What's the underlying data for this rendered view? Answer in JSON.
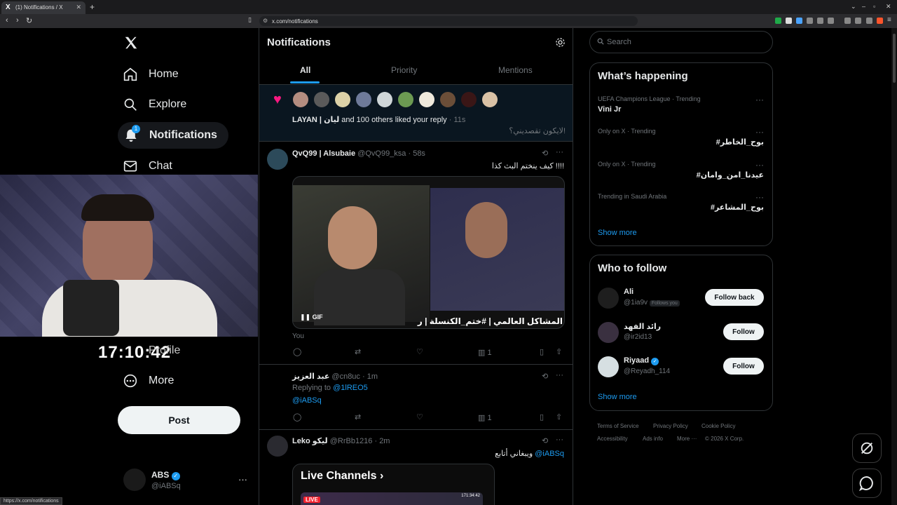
{
  "browser": {
    "tab_title": "(1) Notifications / X",
    "favicon": "X",
    "url": "x.com/notifications",
    "status_url": "https://x.com/notifications"
  },
  "nav": {
    "logo": "X",
    "home": "Home",
    "explore": "Explore",
    "notifications": "Notifications",
    "notifications_badge": "1",
    "chat": "Chat",
    "profile": "Profile",
    "more": "More",
    "post": "Post",
    "account": {
      "name": "ABS",
      "handle": "@iABSq"
    }
  },
  "webcam": {
    "clock": "17:10:42"
  },
  "notifications": {
    "title": "Notifications",
    "tabs": [
      "All",
      "Priority",
      "Mentions"
    ],
    "like_notif": {
      "text_bold": "LAYAN | ليان",
      "text": " and 100 others liked your reply",
      "time": "· 11s",
      "quote": "لايكون تقصديني؟!"
    },
    "tweets": [
      {
        "author": "QvQ99 | Alsubaie",
        "handle": "@QvQ99_ksa · 58s",
        "text": "كيف ينختم البث كذا !!!!",
        "media_caption": "المشاكل العالمي | #ختم_الكنسلة | ر",
        "media_badge": "GIF",
        "you": "You",
        "views": "1"
      },
      {
        "author": "عبد العزيز",
        "handle": "@cn8uc · 1m",
        "replying_to": "Replying to",
        "replying_handle": "@1lREO5",
        "mention": "@iABSq",
        "views": "1"
      },
      {
        "author": "Leko ليكو",
        "handle": "@RrBb1216 · 2m",
        "text": "ويبغاني أتابع",
        "mention": "@iABSq",
        "card_title": "Live Channels",
        "card_time": "171:34:42",
        "card_live": "LIVE"
      }
    ]
  },
  "right": {
    "search_placeholder": "Search",
    "happening_title": "What’s happening",
    "trends": [
      {
        "meta": "UEFA Champions League · Trending",
        "name": "Vini Jr"
      },
      {
        "meta": "Only on X · Trending",
        "name": "#بوح_الخاطر"
      },
      {
        "meta": "Only on X · Trending",
        "name": "#عيدنا_امن_وامان"
      },
      {
        "meta": "Trending in Saudi Arabia",
        "name": "#بوح_المشاعر"
      }
    ],
    "show_more": "Show more",
    "who_title": "Who to follow",
    "follow": [
      {
        "name": "Ali",
        "handle": "@1ia9v",
        "tag": "Follows you",
        "button": "Follow back"
      },
      {
        "name": "رائد الفهد",
        "handle": "@ir2id13",
        "button": "Follow"
      },
      {
        "name": "Riyaad",
        "handle": "@Reyadh_114",
        "button": "Follow"
      }
    ],
    "footer": [
      "Terms of Service",
      "Privacy Policy",
      "Cookie Policy",
      "Accessibility",
      "Ads info",
      "More ···",
      "© 2026 X Corp."
    ]
  },
  "colors": {
    "accent": "#1d9bf0",
    "like": "#f91880",
    "background": "#000000"
  }
}
